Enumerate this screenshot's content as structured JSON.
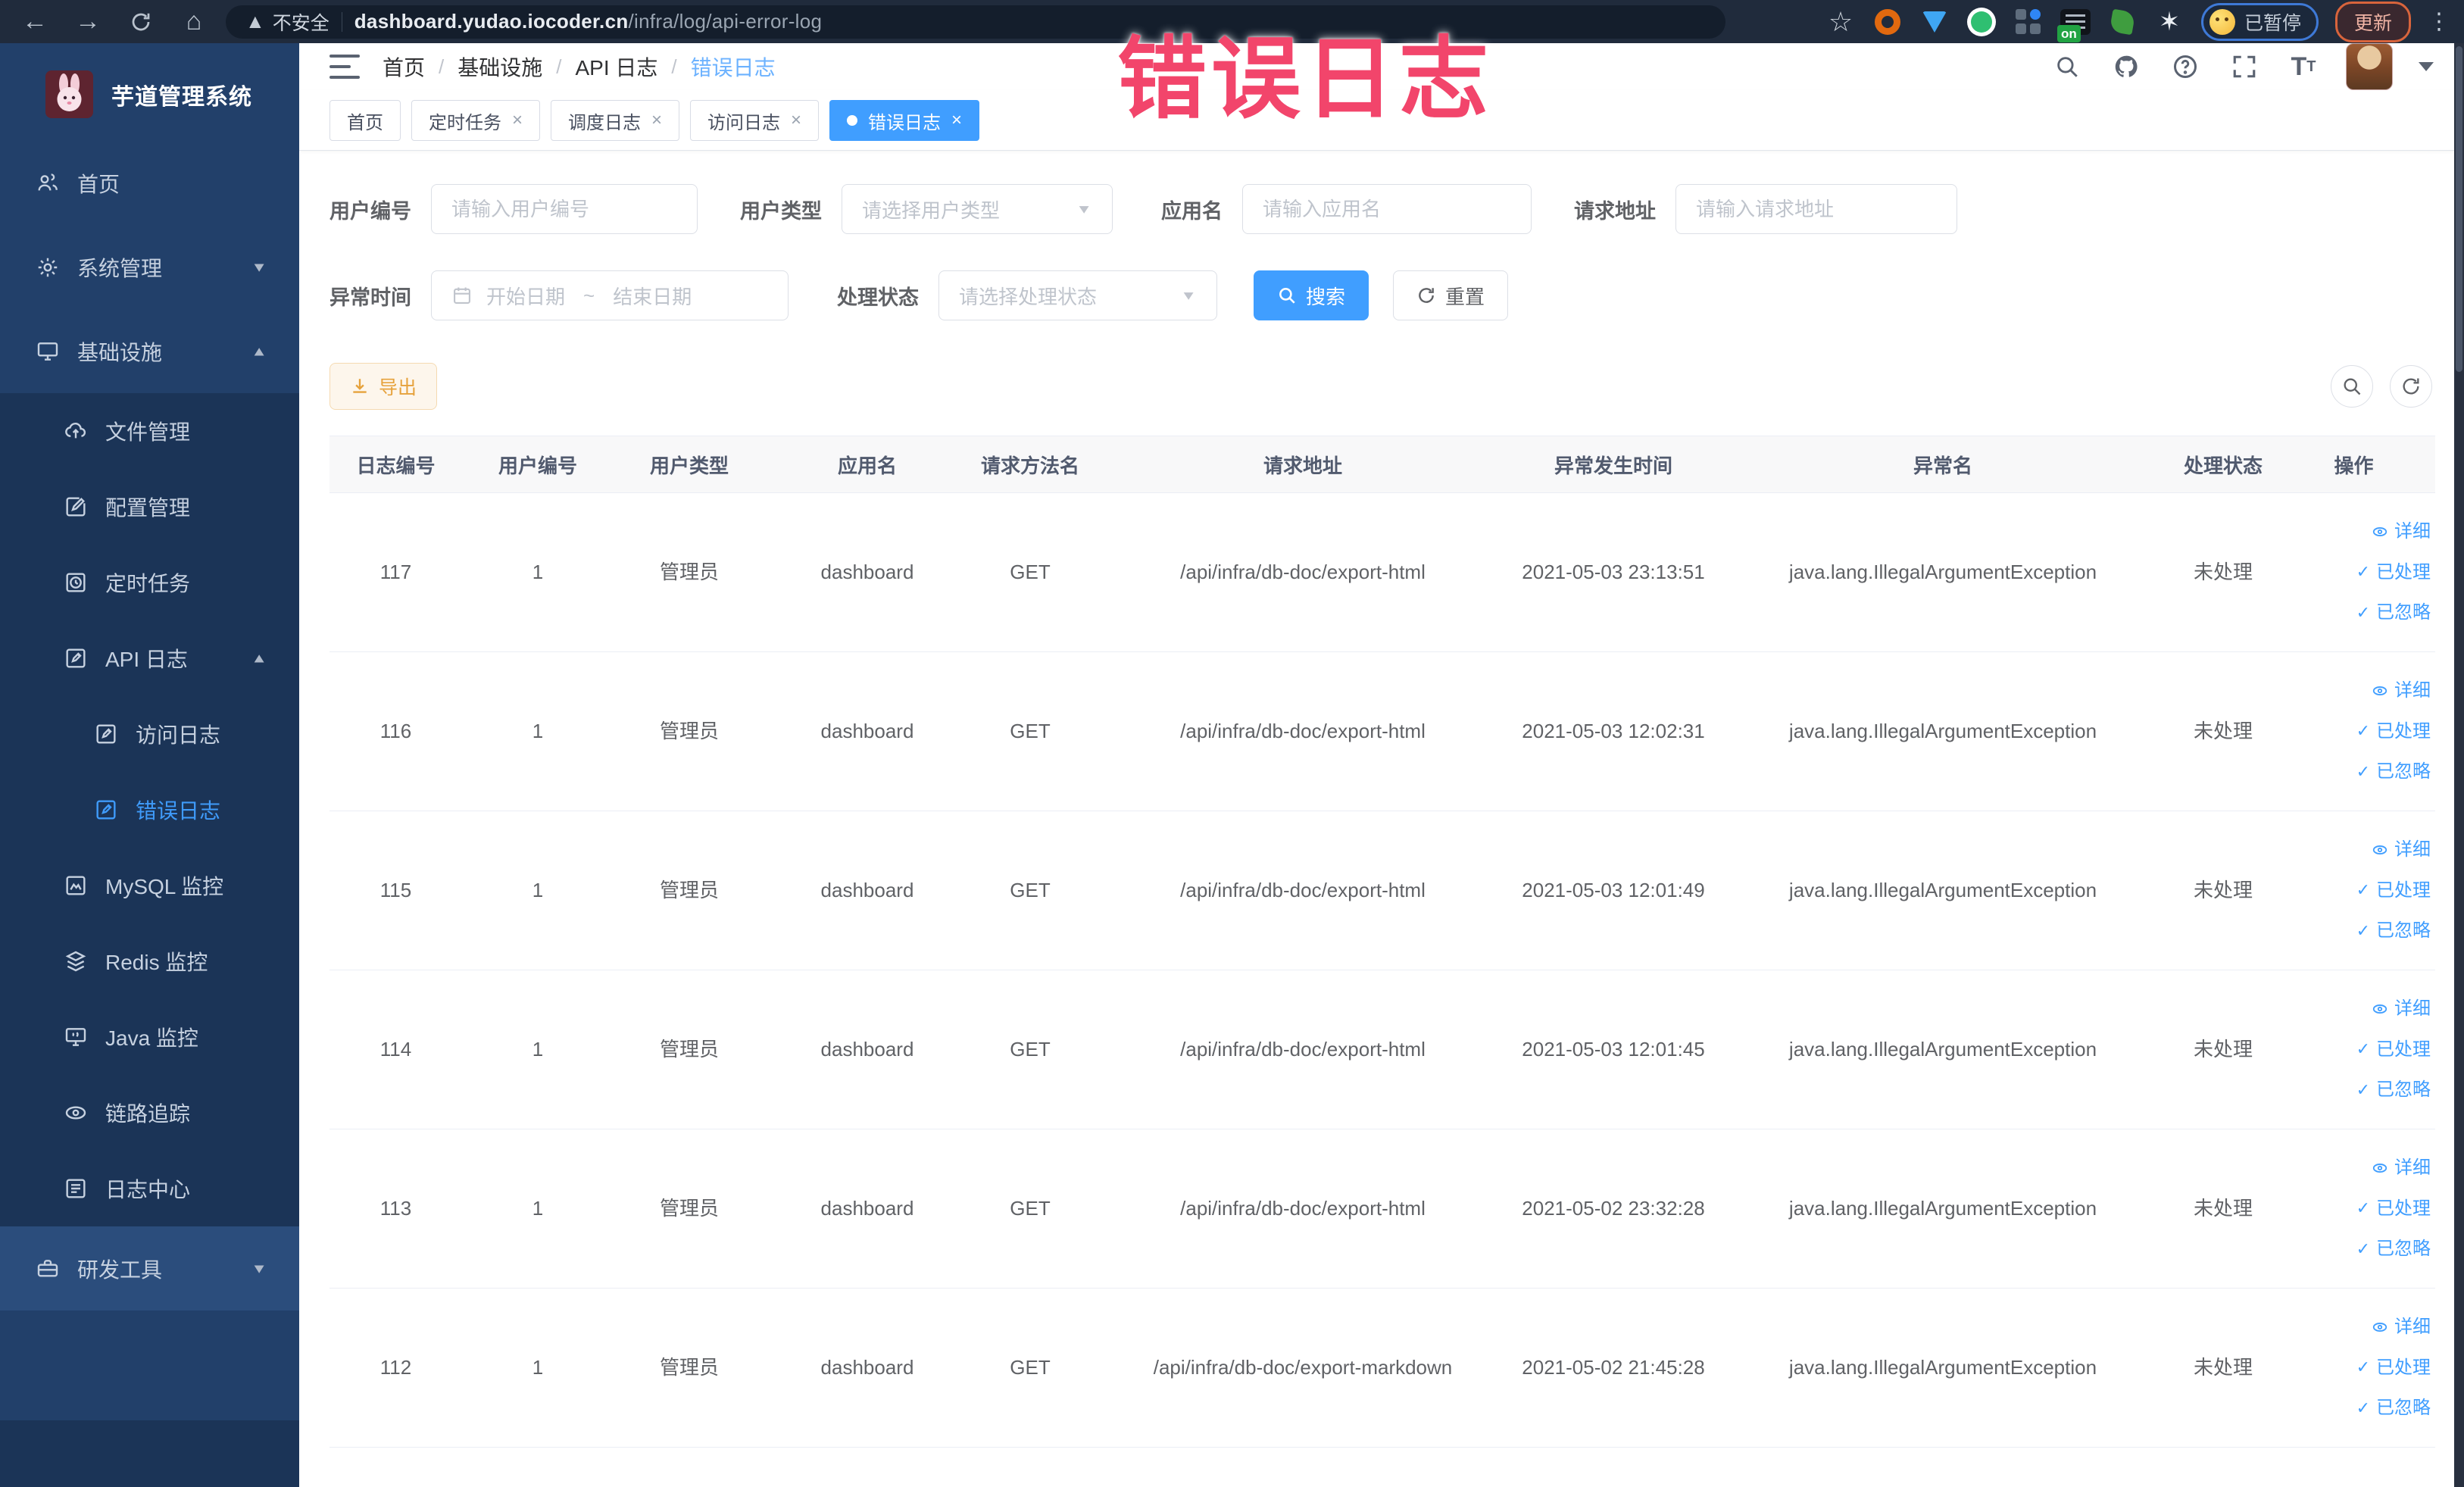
{
  "watermark": "错误日志",
  "browser": {
    "security": "不安全",
    "url_host": "dashboard.yudao.iocoder.cn",
    "url_path": "/infra/log/api-error-log",
    "paused": "已暂停",
    "update": "更新",
    "ext_on_badge": "on"
  },
  "sidebar": {
    "title": "芋道管理系统",
    "home": "首页",
    "system": "系统管理",
    "infra": "基础设施",
    "file": "文件管理",
    "config": "配置管理",
    "job": "定时任务",
    "api_log": "API 日志",
    "access_log": "访问日志",
    "error_log": "错误日志",
    "mysql": "MySQL 监控",
    "redis": "Redis 监控",
    "java": "Java 监控",
    "trace": "链路追踪",
    "log_center": "日志中心",
    "dev_tools": "研发工具"
  },
  "breadcrumb": [
    "首页",
    "基础设施",
    "API 日志",
    "错误日志"
  ],
  "tabs": [
    {
      "label": "首页"
    },
    {
      "label": "定时任务"
    },
    {
      "label": "调度日志"
    },
    {
      "label": "访问日志"
    },
    {
      "label": "错误日志"
    }
  ],
  "filters": {
    "user_id": {
      "label": "用户编号",
      "placeholder": "请输入用户编号"
    },
    "user_type": {
      "label": "用户类型",
      "placeholder": "请选择用户类型"
    },
    "app_name": {
      "label": "应用名",
      "placeholder": "请输入应用名"
    },
    "request_url": {
      "label": "请求地址",
      "placeholder": "请输入请求地址"
    },
    "exception_time": {
      "label": "异常时间",
      "start": "开始日期",
      "separator": "~",
      "end": "结束日期"
    },
    "process_status": {
      "label": "处理状态",
      "placeholder": "请选择处理状态"
    },
    "search": "搜索",
    "reset": "重置"
  },
  "toolbar": {
    "export": "导出"
  },
  "table": {
    "columns": [
      "日志编号",
      "用户编号",
      "用户类型",
      "应用名",
      "请求方法名",
      "请求地址",
      "异常发生时间",
      "异常名",
      "处理状态",
      "操作"
    ],
    "actions": {
      "detail": "详细",
      "processed": "已处理",
      "ignored": "已忽略"
    },
    "rows": [
      {
        "id": "117",
        "user_id": "1",
        "user_type": "管理员",
        "app": "dashboard",
        "method": "GET",
        "url": "/api/infra/db-doc/export-html",
        "time": "2021-05-03 23:13:51",
        "exception": "java.lang.IllegalArgumentException",
        "status": "未处理"
      },
      {
        "id": "116",
        "user_id": "1",
        "user_type": "管理员",
        "app": "dashboard",
        "method": "GET",
        "url": "/api/infra/db-doc/export-html",
        "time": "2021-05-03 12:02:31",
        "exception": "java.lang.IllegalArgumentException",
        "status": "未处理"
      },
      {
        "id": "115",
        "user_id": "1",
        "user_type": "管理员",
        "app": "dashboard",
        "method": "GET",
        "url": "/api/infra/db-doc/export-html",
        "time": "2021-05-03 12:01:49",
        "exception": "java.lang.IllegalArgumentException",
        "status": "未处理"
      },
      {
        "id": "114",
        "user_id": "1",
        "user_type": "管理员",
        "app": "dashboard",
        "method": "GET",
        "url": "/api/infra/db-doc/export-html",
        "time": "2021-05-03 12:01:45",
        "exception": "java.lang.IllegalArgumentException",
        "status": "未处理"
      },
      {
        "id": "113",
        "user_id": "1",
        "user_type": "管理员",
        "app": "dashboard",
        "method": "GET",
        "url": "/api/infra/db-doc/export-html",
        "time": "2021-05-02 23:32:28",
        "exception": "java.lang.IllegalArgumentException",
        "status": "未处理"
      },
      {
        "id": "112",
        "user_id": "1",
        "user_type": "管理员",
        "app": "dashboard",
        "method": "GET",
        "url": "/api/infra/db-doc/export-markdown",
        "time": "2021-05-02 21:45:28",
        "exception": "java.lang.IllegalArgumentException",
        "status": "未处理"
      }
    ]
  },
  "colors": {
    "primary": "#409eff",
    "warning": "#e6a23c",
    "sidebar_bg": "#22406a",
    "submenu_bg": "#1b3457",
    "browser_bg": "#202b3c",
    "watermark_red": "#f2456b"
  }
}
